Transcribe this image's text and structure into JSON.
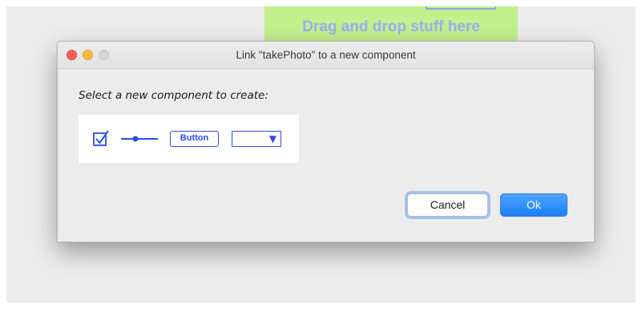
{
  "background": {
    "drop_zone_text": "Drag and drop stuff here"
  },
  "dialog": {
    "title": "Link \"takePhoto\" to a new component",
    "prompt": "Select a new component to create:",
    "palette": {
      "items": [
        {
          "name": "checkbox",
          "icon": "checkbox-checked-icon"
        },
        {
          "name": "slider",
          "icon": "slider-icon"
        },
        {
          "name": "button",
          "label": "Button"
        },
        {
          "name": "dropdown",
          "icon": "dropdown-arrow-icon",
          "arrow": "▼"
        }
      ]
    },
    "buttons": {
      "cancel_label": "Cancel",
      "ok_label": "Ok"
    }
  },
  "colors": {
    "accent": "#2a4cf2",
    "drop_zone": "#c2f08c",
    "ok_button": "#1a7ef7",
    "close": "#fc605c",
    "minimize": "#fdbc40"
  }
}
